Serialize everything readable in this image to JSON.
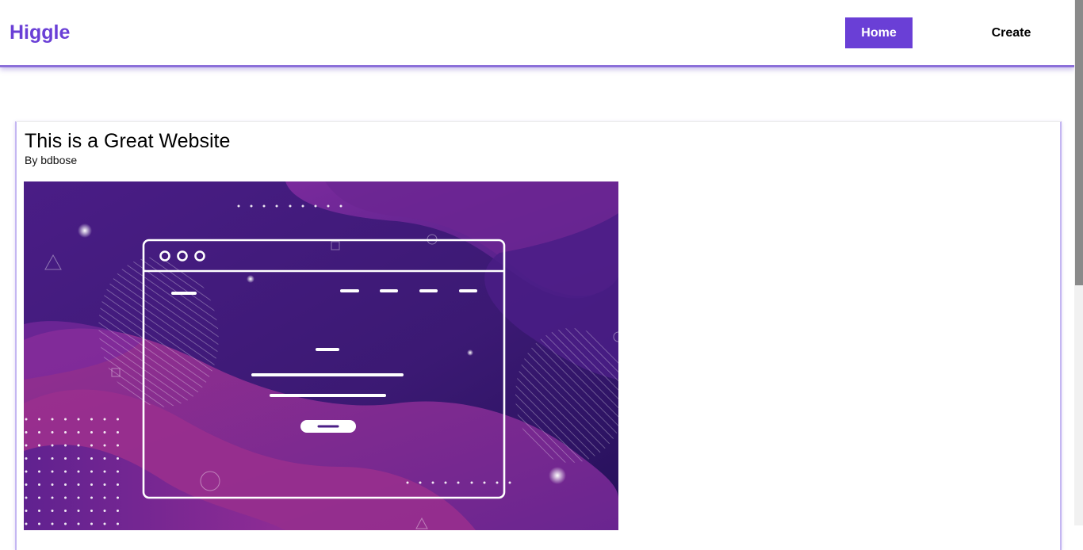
{
  "navbar": {
    "brand": "Higgle",
    "links": [
      {
        "label": "Home",
        "active": true
      },
      {
        "label": "Create",
        "active": false
      }
    ]
  },
  "post": {
    "title": "This is a Great Website",
    "author": "By bdbose",
    "image": {
      "description": "purple fluid-shape banner with browser window illustration"
    }
  },
  "colors": {
    "brand": "#6a3fd6",
    "navbar_border": "#8b6fd9",
    "card_border": "#c4b6f2",
    "image_bg_dark": "#3e1a78",
    "image_bg_magenta": "#8e2a8f"
  }
}
